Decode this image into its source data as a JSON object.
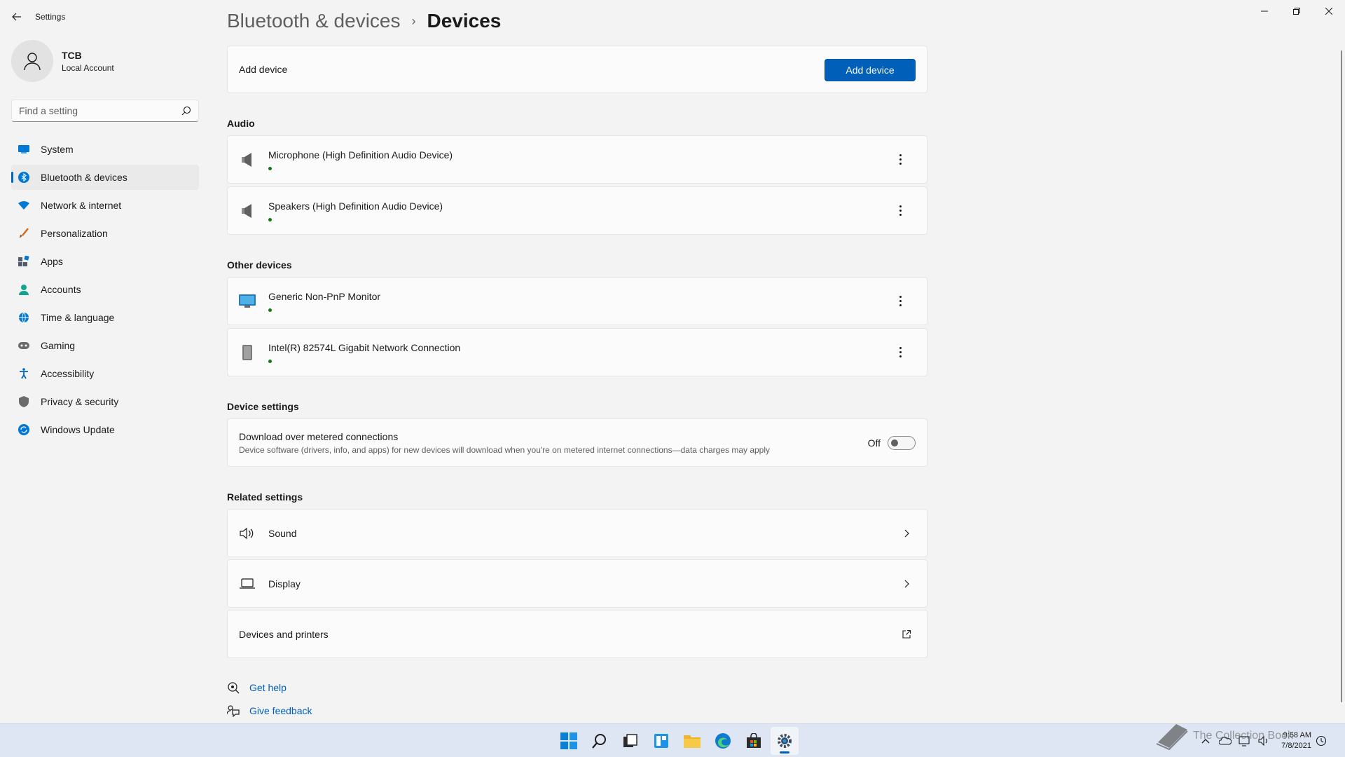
{
  "app": {
    "title": "Settings"
  },
  "profile": {
    "name": "TCB",
    "account_type": "Local Account"
  },
  "search": {
    "placeholder": "Find a setting"
  },
  "nav": [
    {
      "label": "System",
      "icon": "system-icon",
      "color": "#0078d4"
    },
    {
      "label": "Bluetooth & devices",
      "icon": "bluetooth-icon",
      "color": "#0078d4",
      "active": true
    },
    {
      "label": "Network & internet",
      "icon": "wifi-icon",
      "color": "#0078d4"
    },
    {
      "label": "Personalization",
      "icon": "brush-icon",
      "color": "#d46b1a"
    },
    {
      "label": "Apps",
      "icon": "apps-icon",
      "color": "#505c6b"
    },
    {
      "label": "Accounts",
      "icon": "accounts-icon",
      "color": "#13a38f"
    },
    {
      "label": "Time & language",
      "icon": "globe-icon",
      "color": "#0078d4"
    },
    {
      "label": "Gaming",
      "icon": "gamepad-icon",
      "color": "#6b6b6b"
    },
    {
      "label": "Accessibility",
      "icon": "accessibility-icon",
      "color": "#0067c0"
    },
    {
      "label": "Privacy & security",
      "icon": "shield-icon",
      "color": "#6b6b6b"
    },
    {
      "label": "Windows Update",
      "icon": "update-icon",
      "color": "#0078d4"
    }
  ],
  "breadcrumb": {
    "parent": "Bluetooth & devices",
    "separator": "›",
    "current": "Devices"
  },
  "add_device": {
    "label": "Add device",
    "button": "Add device"
  },
  "audio": {
    "title": "Audio",
    "devices": [
      {
        "name": "Microphone (High Definition Audio Device)",
        "icon": "speaker-device-icon",
        "connected": true
      },
      {
        "name": "Speakers (High Definition Audio Device)",
        "icon": "speaker-device-icon",
        "connected": true
      }
    ]
  },
  "other": {
    "title": "Other devices",
    "devices": [
      {
        "name": "Generic Non-PnP Monitor",
        "icon": "monitor-icon",
        "connected": true
      },
      {
        "name": "Intel(R) 82574L Gigabit Network Connection",
        "icon": "network-device-icon",
        "connected": true
      }
    ]
  },
  "device_settings": {
    "title": "Device settings",
    "metered": {
      "title": "Download over metered connections",
      "description": "Device software (drivers, info, and apps) for new devices will download when you're on metered internet connections—data charges may apply",
      "state_label": "Off",
      "on": false
    }
  },
  "related": {
    "title": "Related settings",
    "items": [
      {
        "label": "Sound",
        "icon": "sound-icon",
        "action": "chevron"
      },
      {
        "label": "Display",
        "icon": "display-icon",
        "action": "chevron"
      },
      {
        "label": "Devices and printers",
        "icon": "",
        "action": "external"
      }
    ]
  },
  "help": {
    "get_help": "Get help",
    "give_feedback": "Give feedback"
  },
  "taskbar": {
    "apps": [
      "start-icon",
      "search-icon",
      "task-view-icon",
      "widgets-icon",
      "file-explorer-icon",
      "edge-icon",
      "store-icon",
      "settings-icon"
    ],
    "active": "settings-icon",
    "time": "9:58 AM",
    "date": "7/8/2021"
  },
  "watermark": {
    "text": "The Collection Book"
  },
  "colors": {
    "accent": "#005fb8",
    "status_green": "#0f7b0f"
  }
}
